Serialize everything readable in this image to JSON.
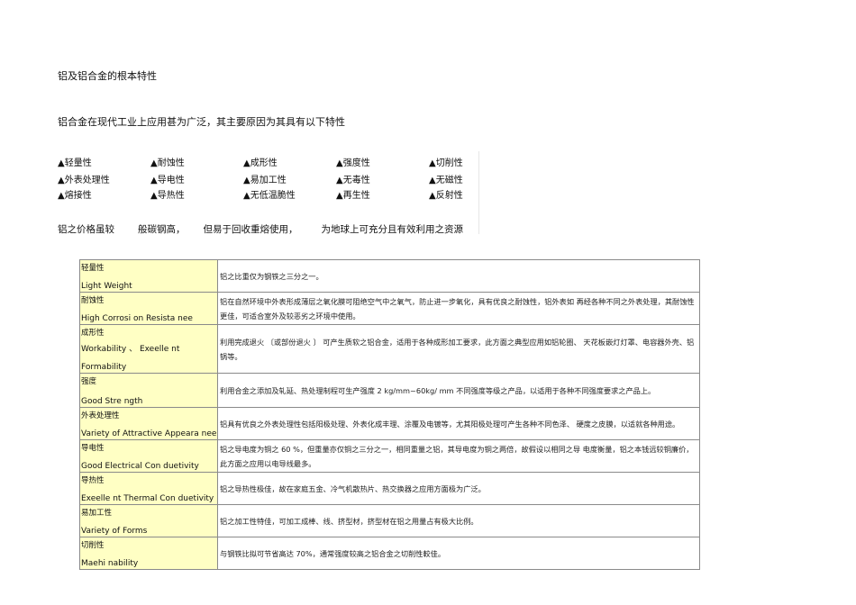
{
  "page": {
    "title": "铝及铝合金的根本特性",
    "intro": "铝合金在现代工业上应用甚为广泛，其主要原因为其具有以下特性",
    "properties": [
      "▲轻量性",
      "▲耐蚀性",
      "▲成形性",
      "▲强度性",
      "▲切削性",
      "▲外表处理性",
      "▲导电性",
      "▲易加工性",
      "▲无毒性",
      "▲无磁性",
      "▲熔接性",
      "▲导热性",
      "▲无低温脆性",
      "▲再生性",
      "▲反射性"
    ],
    "summary": [
      "铝之价格虽较",
      "般碳钢高，",
      "但易于回收重熔使用，",
      "为地球上可充分且有效利用之资源"
    ]
  },
  "table": {
    "rows": [
      {
        "zh": "轻量性",
        "en": "Light Weight",
        "desc": "铝之比重仅为钢铁之三分之一。"
      },
      {
        "zh": "耐蚀性",
        "en": "High Corrosi on Resista nee",
        "desc": "铝在自然环境中外表形成薄层之氧化膜可阻绝空气中之氧气，防止进一步氧化，具有优良之耐蚀性，铝外表如 再经各种不同之外表处理，其耐蚀性更佳，可适合室外及较恶劣之环境中使用。"
      },
      {
        "zh": "成形性",
        "en": "Workability 、 Exeelle nt",
        "en2": "Formability",
        "desc": "利用完成退火 〔或部份退火 〕 可产生质软之铝合金，适用于各种成形加工要求，此方面之典型应用如铝轮圈、 天花板嵌灯灯罩、电容器外壳、铝锅等。"
      },
      {
        "zh": "强度",
        "en": "Good Stre ngth",
        "desc": "利用合金之添加及轧延、热处理制程可生产强度 2 kg/mm~60kg/ mm 不同强度等级之产品，以适用于各种不同强度要求之产品上。"
      },
      {
        "zh": "外表处理性",
        "en": "Variety of Attractive Appeara nee",
        "desc": "铝具有优良之外表处理性包括阳极处理、外表化成丰理、涂覆及电镀等，尤其阳极处理可产生各种不同色泽、 硬度之皮膜，以适就各种用途。"
      },
      {
        "zh": "导电性",
        "en": "Good Electrical Con duetivity",
        "desc": "铝之导电度为铜之 60 %，但重量亦仅铜之三分之一，相同重量之铝，其导电度为铜之两倍，故假设以相同之导 电度衡量，铝之本钱远较铜廉价，此方面之应用以电导线最多。"
      },
      {
        "zh": "导热性",
        "en": "Exeelle nt Thermal Con duetivity",
        "desc": "铝之导热性极佳，故在家庭五金、冷气机散热片、热交换器之应用方面极为广泛。"
      },
      {
        "zh": "易加工性",
        "en": "Variety of Forms",
        "desc": "铝之加工性特佳，可加工成棒、线、挤型材，挤型材在铝之用量占有极大比例。"
      },
      {
        "zh": "切削性",
        "en": "Maehi nability",
        "desc": "与钢铁比拟可节省高达 70%，通常强度较高之铝合金之切削性較佳。"
      }
    ]
  },
  "colors": {
    "name_cell_bg": "#ffffc4",
    "border": "#8a8a8a"
  }
}
